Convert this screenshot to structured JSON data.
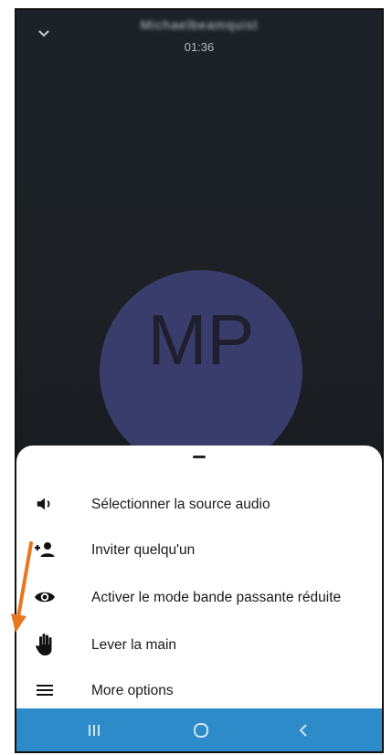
{
  "call": {
    "caller_name": "Michaelbeamquist",
    "timer": "01:36",
    "avatar_initials": "MP",
    "avatar_color": "#3a3c6b"
  },
  "menu": {
    "items": [
      {
        "label": "Sélectionner la source audio",
        "icon": "speaker-icon"
      },
      {
        "label": "Inviter quelqu'un",
        "icon": "add-person-icon"
      },
      {
        "label": "Activer le mode bande passante réduite",
        "icon": "eye-icon"
      },
      {
        "label": "Lever la main",
        "icon": "raise-hand-icon"
      },
      {
        "label": "More options",
        "icon": "menu-lines-icon"
      }
    ]
  },
  "navbar": {
    "color": "#2c8bc8",
    "buttons": [
      "recent-apps-icon",
      "home-icon",
      "back-icon"
    ]
  },
  "annotation": {
    "arrow_color": "#e87722"
  }
}
